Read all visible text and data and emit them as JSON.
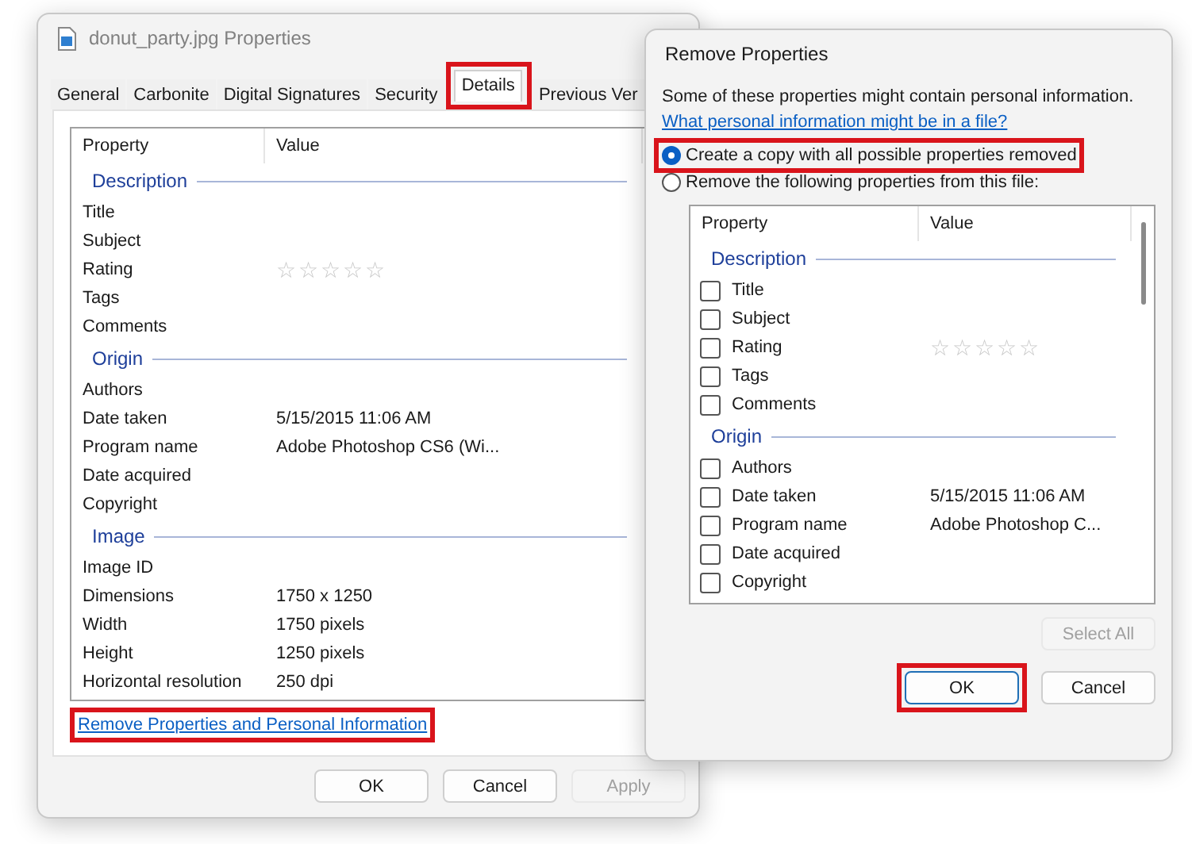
{
  "properties_window": {
    "title": "donut_party.jpg Properties",
    "tabs": [
      {
        "label": "General",
        "selected": false,
        "highlighted": false
      },
      {
        "label": "Carbonite",
        "selected": false,
        "highlighted": false
      },
      {
        "label": "Digital Signatures",
        "selected": false,
        "highlighted": false
      },
      {
        "label": "Security",
        "selected": false,
        "highlighted": false
      },
      {
        "label": "Details",
        "selected": true,
        "highlighted": true
      },
      {
        "label": "Previous Ver",
        "selected": false,
        "highlighted": false
      }
    ],
    "table": {
      "columns": [
        "Property",
        "Value"
      ],
      "groups": [
        {
          "heading": "Description",
          "rows": [
            {
              "property": "Title"
            },
            {
              "property": "Subject"
            },
            {
              "property": "Rating",
              "stars": 0
            },
            {
              "property": "Tags"
            },
            {
              "property": "Comments"
            }
          ]
        },
        {
          "heading": "Origin",
          "rows": [
            {
              "property": "Authors"
            },
            {
              "property": "Date taken",
              "value": "5/15/2015 11:06 AM"
            },
            {
              "property": "Program name",
              "value": "Adobe Photoshop CS6 (Wi..."
            },
            {
              "property": "Date acquired"
            },
            {
              "property": "Copyright"
            }
          ]
        },
        {
          "heading": "Image",
          "rows": [
            {
              "property": "Image ID"
            },
            {
              "property": "Dimensions",
              "value": "1750 x 1250"
            },
            {
              "property": "Width",
              "value": "1750 pixels"
            },
            {
              "property": "Height",
              "value": "1250 pixels"
            },
            {
              "property": "Horizontal resolution",
              "value": "250 dpi"
            }
          ]
        }
      ]
    },
    "remove_link": {
      "text": "Remove Properties and Personal Information",
      "highlighted": true
    },
    "buttons": [
      {
        "label": "OK",
        "disabled": false,
        "highlighted": false
      },
      {
        "label": "Cancel",
        "disabled": false,
        "highlighted": false
      },
      {
        "label": "Apply",
        "disabled": true,
        "highlighted": false
      }
    ]
  },
  "remove_dialog": {
    "title": "Remove Properties",
    "intro": "Some of these properties might contain personal information.",
    "help_link": "What personal information might be in a file?",
    "options": [
      {
        "label": "Create a copy with all possible properties removed",
        "selected": true,
        "highlighted": true
      },
      {
        "label": "Remove the following properties from this file:",
        "selected": false,
        "highlighted": false
      }
    ],
    "table": {
      "columns": [
        "Property",
        "Value"
      ],
      "groups": [
        {
          "heading": "Description",
          "rows": [
            {
              "property": "Title",
              "checked": false
            },
            {
              "property": "Subject",
              "checked": false
            },
            {
              "property": "Rating",
              "checked": false,
              "stars": 0
            },
            {
              "property": "Tags",
              "checked": false
            },
            {
              "property": "Comments",
              "checked": false
            }
          ]
        },
        {
          "heading": "Origin",
          "rows": [
            {
              "property": "Authors",
              "checked": false
            },
            {
              "property": "Date taken",
              "checked": false,
              "value": "5/15/2015 11:06 AM"
            },
            {
              "property": "Program name",
              "checked": false,
              "value": "Adobe Photoshop C..."
            },
            {
              "property": "Date acquired",
              "checked": false
            },
            {
              "property": "Copyright",
              "checked": false
            }
          ]
        }
      ]
    },
    "select_all": {
      "label": "Select All",
      "disabled": true
    },
    "buttons": [
      {
        "label": "OK",
        "disabled": false,
        "highlighted": true,
        "default": true
      },
      {
        "label": "Cancel",
        "disabled": false,
        "highlighted": false,
        "default": false
      }
    ]
  }
}
